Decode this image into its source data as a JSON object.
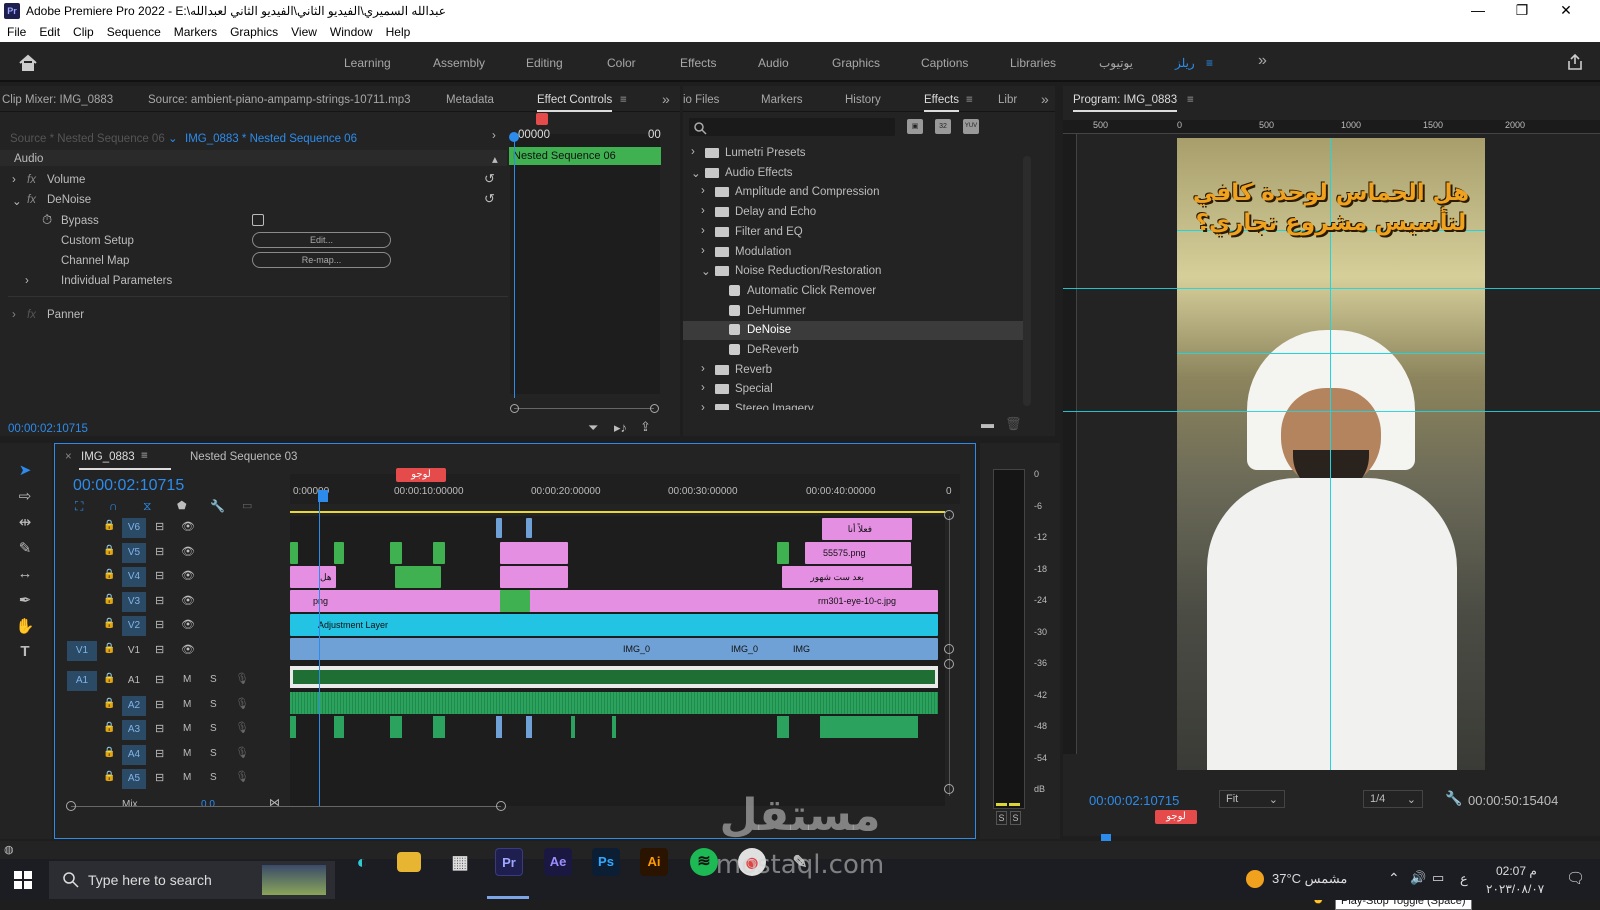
{
  "window": {
    "app_icon": "Pr",
    "title": "Adobe Premiere Pro 2022 - E:\\عبدالله السميري\\الفيديو الثاني\\الفيديو الثاني لعبدالله",
    "minimize": "—",
    "maximize": "❐",
    "close": "✕"
  },
  "menu": [
    "File",
    "Edit",
    "Clip",
    "Sequence",
    "Markers",
    "Graphics",
    "View",
    "Window",
    "Help"
  ],
  "workspaces": [
    "Learning",
    "Assembly",
    "Editing",
    "Color",
    "Effects",
    "Audio",
    "Graphics",
    "Captions",
    "Libraries",
    "يوتيوب",
    "ريلز"
  ],
  "workspace_more": "»",
  "source_panel": {
    "tabs": [
      "Clip Mixer: IMG_0883",
      "Source: ambient-piano-ampamp-strings-10711.mp3",
      "Metadata",
      "Effect Controls"
    ],
    "more": "»",
    "source_dropdown": "Source * Nested Sequence 06",
    "target_dropdown": "IMG_0883 * Nested Sequence 06",
    "mini_time": "00000",
    "mini_time_end": "00",
    "mini_clip": "Nested Sequence 06",
    "section": "Audio",
    "effects": [
      {
        "name": "Volume",
        "fx": "fx"
      },
      {
        "name": "DeNoise",
        "fx": "fx"
      }
    ],
    "params": [
      {
        "label": "Bypass"
      },
      {
        "label": "Custom Setup",
        "button": "Edit..."
      },
      {
        "label": "Channel Map",
        "button": "Re-map..."
      },
      {
        "label": "Individual Parameters"
      }
    ],
    "panner": "Panner",
    "timecode": "00:00:02:10715"
  },
  "effects_panel": {
    "tabs": [
      "io Files",
      "Markers",
      "History",
      "Effects",
      "Libr"
    ],
    "more": "»",
    "preset_buttons": [
      "32",
      "32",
      "YUV"
    ],
    "tree": [
      {
        "label": "Lumetri Presets",
        "level": 0,
        "type": "folder",
        "open": false
      },
      {
        "label": "Audio Effects",
        "level": 0,
        "type": "folder",
        "open": true
      },
      {
        "label": "Amplitude and Compression",
        "level": 1,
        "type": "folder",
        "open": false
      },
      {
        "label": "Delay and Echo",
        "level": 1,
        "type": "folder",
        "open": false
      },
      {
        "label": "Filter and EQ",
        "level": 1,
        "type": "folder",
        "open": false
      },
      {
        "label": "Modulation",
        "level": 1,
        "type": "folder",
        "open": false
      },
      {
        "label": "Noise Reduction/Restoration",
        "level": 1,
        "type": "folder",
        "open": true
      },
      {
        "label": "Automatic Click Remover",
        "level": 2,
        "type": "effect"
      },
      {
        "label": "DeHummer",
        "level": 2,
        "type": "effect"
      },
      {
        "label": "DeNoise",
        "level": 2,
        "type": "effect",
        "selected": true
      },
      {
        "label": "DeReverb",
        "level": 2,
        "type": "effect"
      },
      {
        "label": "Reverb",
        "level": 1,
        "type": "folder",
        "open": false
      },
      {
        "label": "Special",
        "level": 1,
        "type": "folder",
        "open": false
      },
      {
        "label": "Stereo Imagery",
        "level": 1,
        "type": "folder",
        "open": false
      }
    ]
  },
  "program_monitor": {
    "title": "Program: IMG_0883",
    "ruler": [
      "500",
      "0",
      "500",
      "1000",
      "1500",
      "2000"
    ],
    "caption": "هل الحماس لوحدة كافي لتأسيس مشروع تجاري؟",
    "timecode": "00:00:02:10715",
    "fit": "Fit",
    "quality": "1/4",
    "duration": "00:00:50:15404",
    "marker": "لوجو",
    "tooltip": "Play-Stop Toggle (Space)"
  },
  "timeline": {
    "tabs": [
      "IMG_0883",
      "Nested Sequence 03"
    ],
    "timecode": "00:00:02:10715",
    "ruler": [
      "0:00000",
      "00:00:10:00000",
      "00:00:20:00000",
      "00:00:30:00000",
      "00:00:40:00000",
      "0"
    ],
    "marker": "لوجو",
    "video_tracks": [
      {
        "id": "V6",
        "src": ""
      },
      {
        "id": "V5",
        "src": ""
      },
      {
        "id": "V4",
        "src": ""
      },
      {
        "id": "V3",
        "src": ""
      },
      {
        "id": "V2",
        "src": ""
      },
      {
        "id": "V1",
        "src": "V1"
      }
    ],
    "audio_tracks": [
      {
        "id": "A1",
        "src": "A1"
      },
      {
        "id": "A2",
        "src": ""
      },
      {
        "id": "A3",
        "src": ""
      },
      {
        "id": "A4",
        "src": ""
      },
      {
        "id": "A5",
        "src": ""
      }
    ],
    "mix_label": "Mix",
    "mix_value": "0.0",
    "clip_labels": {
      "v6": "فعلاً أنا",
      "v5": "55575.png",
      "v4a": "هل",
      "v4b": "بعد ست شهور",
      "v3a": "png",
      "v3b": "rm301-eye-10-c.jpg",
      "v2": "Adjustment Layer",
      "v1a": "IMG_0",
      "v1b": "IMG_0",
      "v1c": "IMG"
    }
  },
  "meter": {
    "scale": [
      "0",
      "-6",
      "-12",
      "-18",
      "-24",
      "-30",
      "-36",
      "-42",
      "-48",
      "-54",
      "dB"
    ],
    "solo": [
      "S",
      "S"
    ]
  },
  "taskbar": {
    "search_placeholder": "Type here to search",
    "apps": [
      "Ps",
      "Ae",
      "Pr",
      "Ai"
    ],
    "weather": "37°C مشمس",
    "lang": "ع",
    "time": "02:07 م",
    "date": "٢٠٢٣/٠٨/٠٧"
  },
  "watermark": {
    "ar": "مستقل",
    "latin": "mostaql.com"
  },
  "colors": {
    "accent": "#2d8ceb",
    "clip_pink": "#e58fe3",
    "clip_green": "#3fb151",
    "clip_blue": "#6fa1d6",
    "clip_cyan": "#22c3e3",
    "audio": "#2ba35f",
    "guide": "#1fd5e0"
  }
}
